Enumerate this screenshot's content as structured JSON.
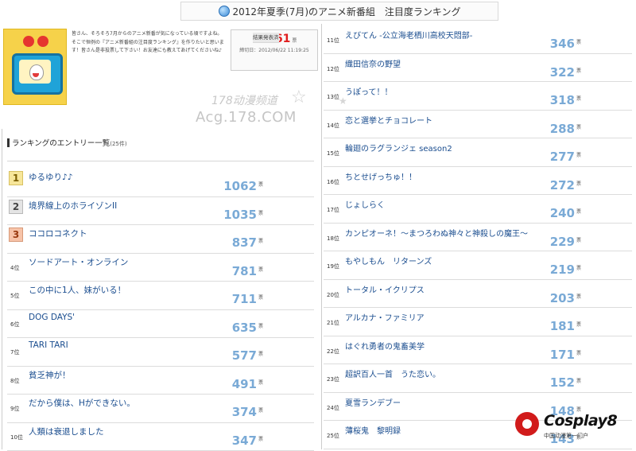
{
  "header": {
    "title": "2012年夏季(7月)のアニメ新番組　注目度ランキング"
  },
  "intro": {
    "text": "皆さん、そろそろ7月からのアニメ新番が気になっている頃ですよね。そこで恒例の『アニメ新番組の注目度ランキング』を作りたいと思います！皆さん是非投票して下さい！お友達にも教えてあげてくださいね♪"
  },
  "result": {
    "label": "結果発表済",
    "count": "10361",
    "unit": "票",
    "date": "締切日：2012/06/22 11:19:25"
  },
  "watermark": {
    "line1": "178动漫频道",
    "line2": "Acg.178.COM"
  },
  "list": {
    "title": "ランキングのエントリー一覧",
    "count": "(25件)"
  },
  "unit": "票",
  "left_entries": [
    {
      "rank": "1",
      "title": "ゆるゆり♪♪",
      "votes": "1062"
    },
    {
      "rank": "2",
      "title": "境界線上のホライゾンII",
      "votes": "1035"
    },
    {
      "rank": "3",
      "title": "ココロコネクト",
      "votes": "837"
    },
    {
      "rank": "4位",
      "title": "ソードアート・オンライン",
      "votes": "781"
    },
    {
      "rank": "5位",
      "title": "この中に1人、妹がいる！",
      "votes": "711"
    },
    {
      "rank": "6位",
      "title": "DOG DAYS'",
      "votes": "635"
    },
    {
      "rank": "7位",
      "title": "TARI TARI",
      "votes": "577"
    },
    {
      "rank": "8位",
      "title": "貧乏神が！",
      "votes": "491"
    },
    {
      "rank": "9位",
      "title": "だから僕は、Hができない。",
      "votes": "374"
    },
    {
      "rank": "10位",
      "title": "人類は衰退しました",
      "votes": "347"
    }
  ],
  "right_entries": [
    {
      "rank": "11位",
      "title": "えびてん -公立海老栖川高校天悶部-",
      "votes": "346"
    },
    {
      "rank": "12位",
      "title": "織田信奈の野望",
      "votes": "322"
    },
    {
      "rank": "13位",
      "title": "うぽって！！",
      "votes": "318"
    },
    {
      "rank": "14位",
      "title": "恋と選挙とチョコレート",
      "votes": "288"
    },
    {
      "rank": "15位",
      "title": "輪廻のラグランジェ season2",
      "votes": "277"
    },
    {
      "rank": "16位",
      "title": "ちとせげっちゅ！！",
      "votes": "272"
    },
    {
      "rank": "17位",
      "title": "じょしらく",
      "votes": "240"
    },
    {
      "rank": "18位",
      "title": "カンピオーネ！～まつろわぬ神々と神殺しの魔王～",
      "votes": "229"
    },
    {
      "rank": "19位",
      "title": "もやしもん　リターンズ",
      "votes": "219"
    },
    {
      "rank": "20位",
      "title": "トータル・イクリプス",
      "votes": "203"
    },
    {
      "rank": "21位",
      "title": "アルカナ・ファミリア",
      "votes": "181"
    },
    {
      "rank": "22位",
      "title": "はぐれ勇者の鬼畜美学",
      "votes": "171"
    },
    {
      "rank": "23位",
      "title": "超訳百人一首　うた恋い。",
      "votes": "152"
    },
    {
      "rank": "24位",
      "title": "夏雪ランデブー",
      "votes": "148"
    },
    {
      "rank": "25位",
      "title": "薄桜鬼　黎明録",
      "votes": "143"
    }
  ],
  "logo": {
    "name": "Cosplay8",
    "sub": "中国动漫第一门户"
  }
}
